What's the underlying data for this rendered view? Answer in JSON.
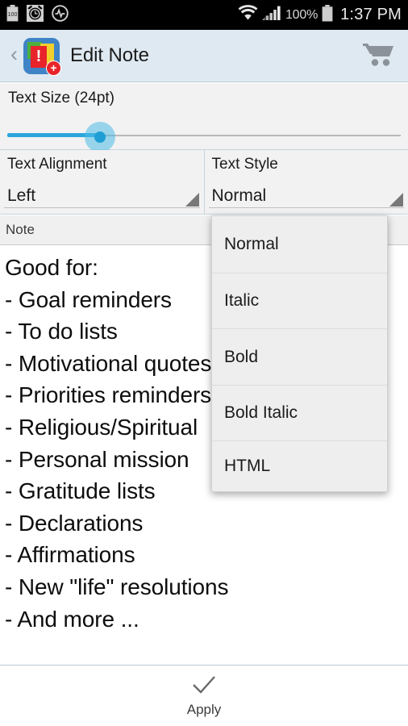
{
  "status_bar": {
    "left_icons": [
      "battery-100-icon",
      "alarm-clock-icon",
      "activity-pulse-icon"
    ],
    "battery_glyph_text": "100",
    "right_icons": [
      "wifi-icon",
      "signal-bars-icon",
      "battery-icon"
    ],
    "battery_percent": "100%",
    "time": "1:37 PM"
  },
  "action_bar": {
    "back_glyph": "‹",
    "app_icon": "note-exclamation-add-icon",
    "icon_bang": "!",
    "icon_plus": "+",
    "title": "Edit Note",
    "cart_icon": "shopping-cart-icon"
  },
  "text_size": {
    "label": "Text Size (24pt)",
    "value_pt": 24,
    "slider_percent": 23
  },
  "text_alignment": {
    "label": "Text Alignment",
    "value": "Left",
    "arrow_icon": "dropdown-triangle-icon"
  },
  "text_style": {
    "label": "Text Style",
    "value": "Normal",
    "arrow_icon": "dropdown-triangle-icon"
  },
  "style_dropdown": {
    "open": true,
    "options": [
      "Normal",
      "Italic",
      "Bold",
      "Bold Italic",
      "HTML"
    ]
  },
  "note": {
    "label": "Note",
    "lines": [
      "Good for:",
      "- Goal reminders",
      "- To do lists",
      "- Motivational quotes",
      "- Priorities reminders",
      "- Religious/Spiritual",
      "- Personal mission",
      "- Gratitude lists",
      "- Declarations",
      "- Affirmations",
      "- New \"life\" resolutions",
      "- And more ..."
    ]
  },
  "apply": {
    "icon": "checkmark-icon",
    "label": "Apply"
  },
  "colors": {
    "accent_blue": "#2ba6dd",
    "action_bar_bg": "#dfe9f1",
    "panel_bg": "#f2f2f2",
    "dropdown_bg": "#eeeeee",
    "status_bar_bg": "#000000"
  }
}
